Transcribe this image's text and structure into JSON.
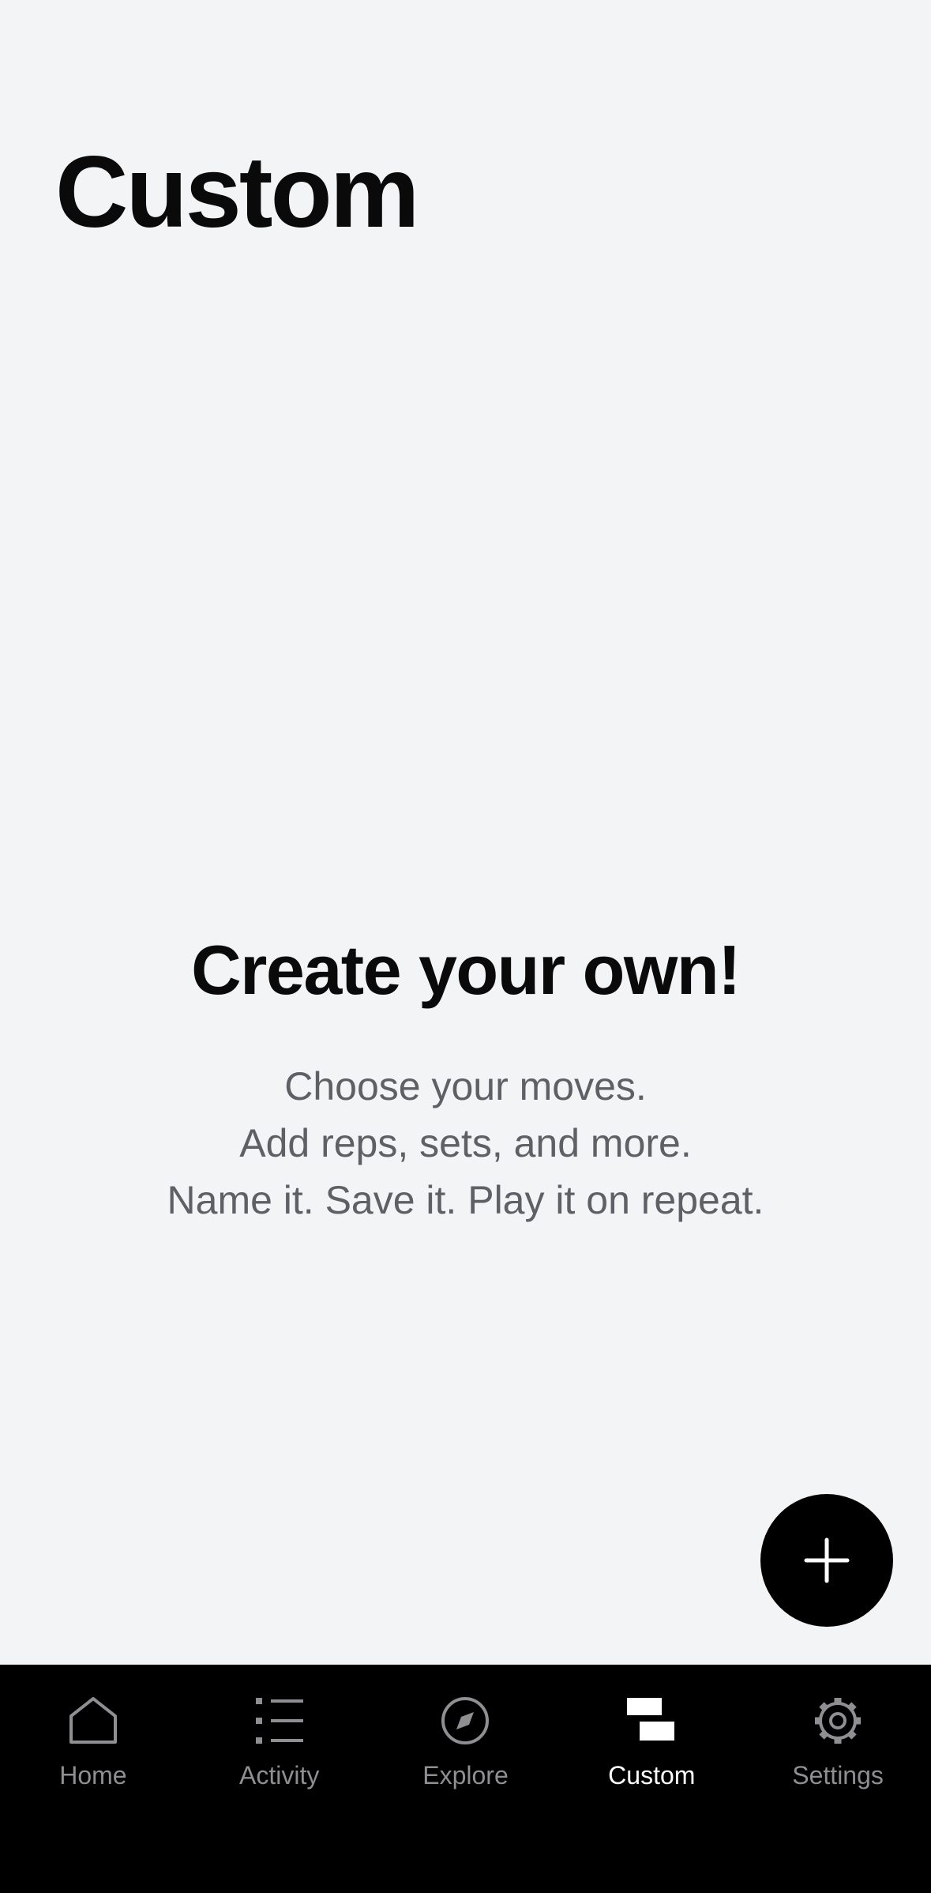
{
  "header": {
    "title": "Custom"
  },
  "empty_state": {
    "title": "Create your own!",
    "lines": [
      "Choose your moves.",
      "Add reps, sets, and more.",
      "Name it. Save it. Play it on repeat."
    ]
  },
  "fab": {
    "icon": "plus-icon"
  },
  "tabbar": {
    "active_tab": "Custom",
    "tabs": [
      {
        "label": "Home",
        "icon": "home-icon"
      },
      {
        "label": "Activity",
        "icon": "list-icon"
      },
      {
        "label": "Explore",
        "icon": "compass-icon"
      },
      {
        "label": "Custom",
        "icon": "custom-blocks-icon"
      },
      {
        "label": "Settings",
        "icon": "gear-icon"
      }
    ]
  },
  "colors": {
    "background": "#f3f4f6",
    "tabbar_background": "#000000",
    "fab_background": "#000000",
    "primary_text": "#0a0a0a",
    "secondary_text": "#5f6066",
    "inactive_tab": "#8e8e93",
    "active_tab": "#ffffff"
  }
}
